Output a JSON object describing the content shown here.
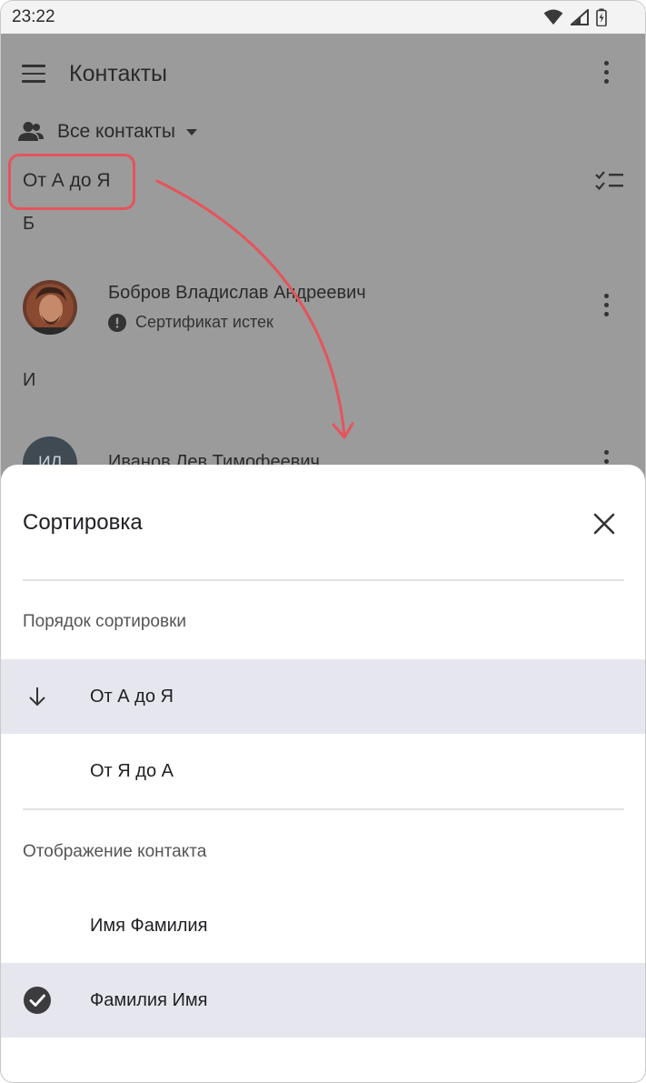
{
  "status_bar": {
    "time": "23:22"
  },
  "header": {
    "title": "Контакты"
  },
  "filter": {
    "label": "Все контакты"
  },
  "sort_current": "От А до Я",
  "contacts": {
    "groups": [
      {
        "letter": "Б",
        "name": "Бобров Владислав Андреевич",
        "status": "Сертификат истек"
      },
      {
        "letter": "И",
        "name": "Иванов Лев Тимофеевич",
        "initials": "ИЛ"
      }
    ]
  },
  "sheet": {
    "title": "Сортировка",
    "sort_section": {
      "label": "Порядок сортировки",
      "options": [
        {
          "label": "От А до Я",
          "selected": true
        },
        {
          "label": "От Я до А",
          "selected": false
        }
      ]
    },
    "display_section": {
      "label": "Отображение контакта",
      "options": [
        {
          "label": "Имя Фамилия",
          "selected": false
        },
        {
          "label": "Фамилия Имя",
          "selected": true
        }
      ]
    }
  },
  "colors": {
    "overlay": "#9b9b9b",
    "highlight": "#e5545b",
    "selected_row": "#e6e6ee"
  },
  "icons": [
    "wifi-icon",
    "signal-icon",
    "battery-icon",
    "menu-icon",
    "more-vert-icon",
    "contacts-group-icon",
    "checklist-icon",
    "warning-icon",
    "close-icon",
    "arrow-down-icon",
    "check-circle-icon"
  ]
}
